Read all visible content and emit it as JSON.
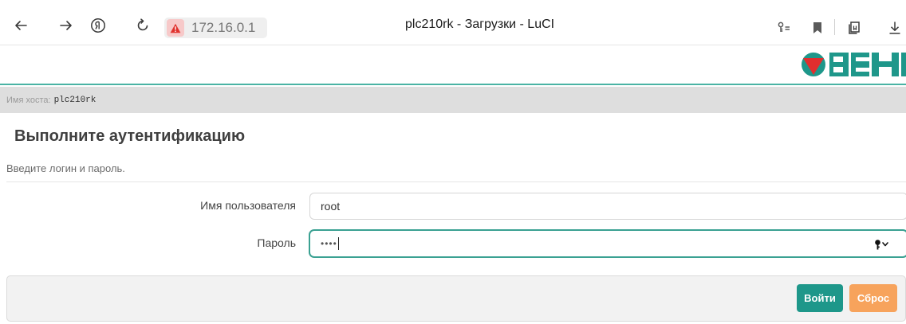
{
  "browser": {
    "address": "172.16.0.1",
    "tab_title": "plc210rk - Загрузки - LuCI"
  },
  "brand": {
    "logo_text": "ОВЕН",
    "accent_color": "#4ab3a4",
    "logo_color": "#1e978a",
    "logo_mark_color": "#e12e2e"
  },
  "host": {
    "label": "Имя хоста:",
    "value": "plc210rk"
  },
  "auth": {
    "title": "Выполните аутентификацию",
    "description": "Введите логин и пароль.",
    "username_label": "Имя пользователя",
    "username_value": "root",
    "password_label": "Пароль",
    "password_mask": "••••"
  },
  "actions": {
    "login_label": "Войти",
    "reset_label": "Сброс",
    "login_color": "#1e978a",
    "reset_color": "#f7a35c"
  },
  "icons": {
    "back": "arrow-left-icon",
    "forward": "arrow-right-icon",
    "yandex": "yandex-icon",
    "reload": "reload-icon",
    "warning": "warning-icon",
    "passwords": "key-manager-icon",
    "bookmark": "bookmark-icon",
    "collections": "collections-icon",
    "download": "download-icon",
    "password_key": "key-icon"
  }
}
